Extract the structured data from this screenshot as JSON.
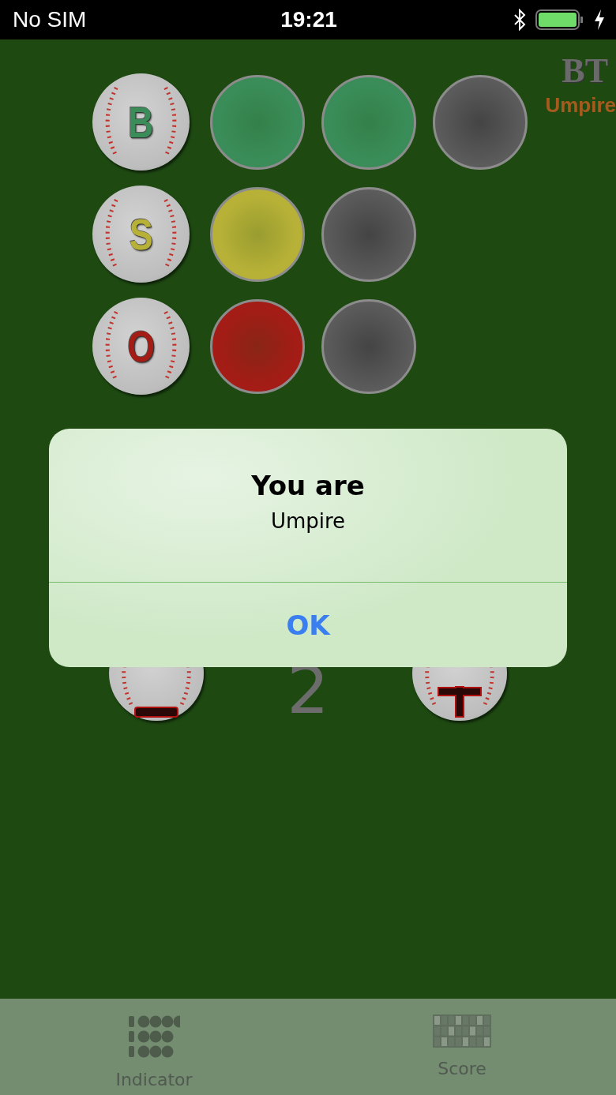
{
  "status_bar": {
    "carrier": "No SIM",
    "time": "19:21"
  },
  "counters": [
    {
      "letter": "B",
      "color": "#3a8d58",
      "lamps": [
        {
          "on": true
        },
        {
          "on": true
        },
        {
          "on": false
        }
      ]
    },
    {
      "letter": "S",
      "color": "#b7b137",
      "lamps": [
        {
          "on": true
        },
        {
          "on": false
        }
      ]
    },
    {
      "letter": "O",
      "color": "#a31c16",
      "lamps": [
        {
          "on": true
        },
        {
          "on": false
        }
      ]
    }
  ],
  "logo": {
    "mark": "BT",
    "role": "Umpire"
  },
  "stepper": {
    "value": "2"
  },
  "alert": {
    "title": "You are",
    "message": "Umpire",
    "button": "OK"
  },
  "tabs": [
    {
      "label": "Indicator",
      "kind": "indicator"
    },
    {
      "label": "Score",
      "kind": "scoreboard"
    }
  ]
}
